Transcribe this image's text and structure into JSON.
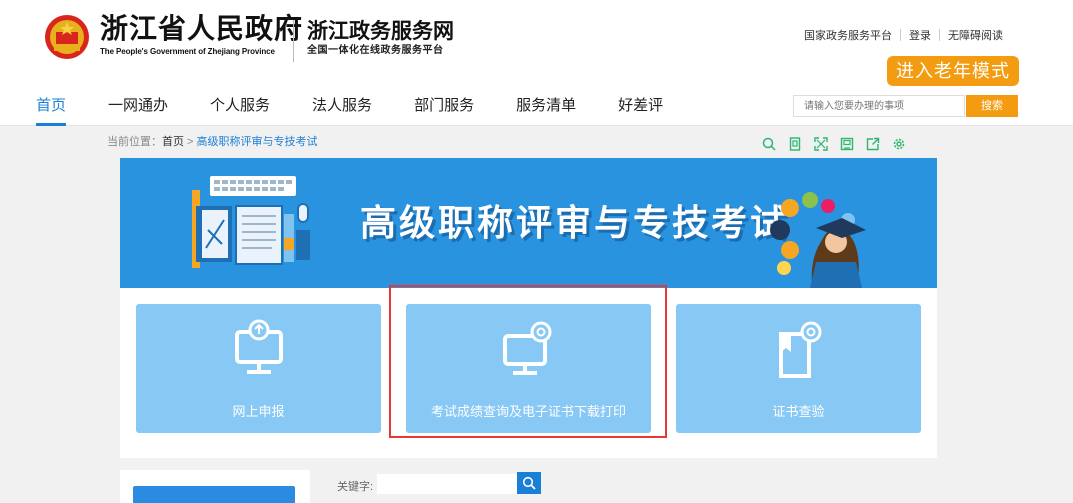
{
  "header": {
    "brand_title": "浙江省人民政府",
    "brand_subtitle": "The People's Government of Zhejiang Province",
    "service_title": "浙江政务服务网",
    "service_subtitle": "全国一体化在线政务服务平台",
    "top_links": [
      "国家政务服务平台",
      "登录",
      "无障碍阅读"
    ],
    "elder_mode": "进入老年模式"
  },
  "nav": {
    "items": [
      "首页",
      "一网通办",
      "个人服务",
      "法人服务",
      "部门服务",
      "服务清单",
      "好差评"
    ],
    "active": "首页"
  },
  "search": {
    "placeholder": "请输入您要办理的事项",
    "button": "搜索"
  },
  "breadcrumb": {
    "prefix": "当前位置：",
    "home": "首页",
    "separator": " > ",
    "current": "高级职称评审与专技考试"
  },
  "toolbar_icons": [
    "search-zoom-icon",
    "document-icon",
    "fullscreen-icon",
    "save-icon",
    "share-icon",
    "settings-icon"
  ],
  "banner": {
    "title": "高级职称评审与专技考试"
  },
  "cards": [
    {
      "label": "网上申报"
    },
    {
      "label": "考试成绩查询及电子证书下载打印"
    },
    {
      "label": "证书查验"
    }
  ],
  "filter": {
    "keyword_label": "关键字:"
  },
  "colors": {
    "accent_blue": "#1a7fd6",
    "orange": "#f39c12",
    "card_blue": "#88c8f5",
    "banner_blue": "#2a93e0",
    "highlight_red": "#e53935"
  }
}
